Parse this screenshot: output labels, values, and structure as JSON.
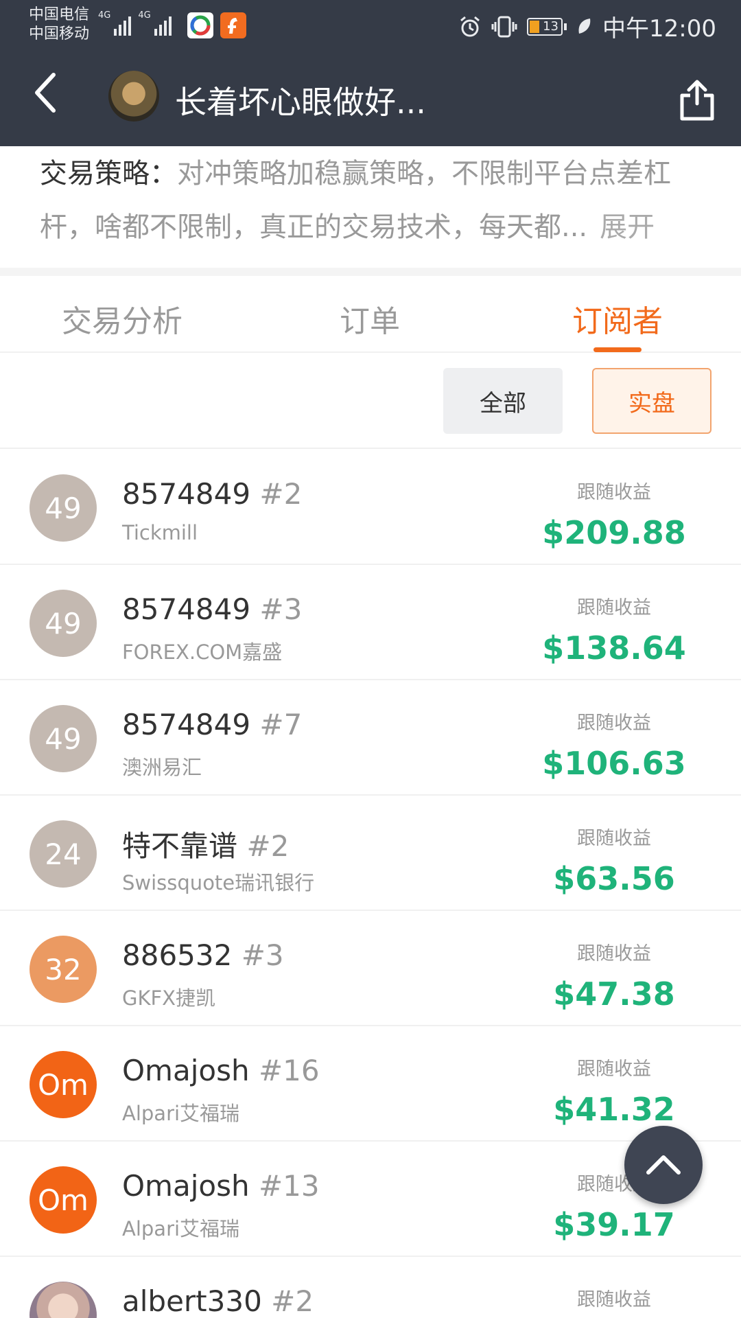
{
  "status_bar": {
    "carrier_1": "中国电信",
    "carrier_2": "中国移动",
    "network_1": "4G",
    "network_2": "4G",
    "battery": "13",
    "time": "中午12:00"
  },
  "nav": {
    "title": "长着坏心眼做好..."
  },
  "strategy": {
    "label": "交易策略：",
    "text": "对冲策略加稳赢策略，不限制平台点差杠杆，啥都不限制，真正的交易技术，每天都...",
    "expand": "展开"
  },
  "tabs": [
    {
      "label": "交易分析",
      "active": false
    },
    {
      "label": "订单",
      "active": false
    },
    {
      "label": "订阅者",
      "active": true
    }
  ],
  "filters": {
    "all": "全部",
    "real": "实盘"
  },
  "subscribers": [
    {
      "avatar_text": "49",
      "avatar_color": "#c4b9b1",
      "name": "8574849",
      "num": "#2",
      "broker": "Tickmill",
      "earn_label": "跟随收益",
      "earn": "$209.88"
    },
    {
      "avatar_text": "49",
      "avatar_color": "#c4b9b1",
      "name": "8574849",
      "num": "#3",
      "broker": "FOREX.COM嘉盛",
      "earn_label": "跟随收益",
      "earn": "$138.64"
    },
    {
      "avatar_text": "49",
      "avatar_color": "#c4b9b1",
      "name": "8574849",
      "num": "#7",
      "broker": "澳洲易汇",
      "earn_label": "跟随收益",
      "earn": "$106.63"
    },
    {
      "avatar_text": "24",
      "avatar_color": "#c4b9b1",
      "name": "特不靠谱",
      "num": "#2",
      "broker": "Swissquote瑞讯银行",
      "earn_label": "跟随收益",
      "earn": "$63.56"
    },
    {
      "avatar_text": "32",
      "avatar_color": "#eb9a62",
      "name": "886532",
      "num": "#3",
      "broker": "GKFX捷凯",
      "earn_label": "跟随收益",
      "earn": "$47.38"
    },
    {
      "avatar_text": "Om",
      "avatar_color": "#f26416",
      "name": "Omajosh",
      "num": "#16",
      "broker": "Alpari艾福瑞",
      "earn_label": "跟随收益",
      "earn": "$41.32"
    },
    {
      "avatar_text": "Om",
      "avatar_color": "#f26416",
      "name": "Omajosh",
      "num": "#13",
      "broker": "Alpari艾福瑞",
      "earn_label": "跟随收益",
      "earn": "$39.17"
    },
    {
      "avatar_text": "",
      "avatar_color": "",
      "name": "albert330",
      "num": "#2",
      "broker": "",
      "earn_label": "跟随收益",
      "earn": ""
    }
  ],
  "colors": {
    "header_bg": "#353b47",
    "accent": "#f26a1b",
    "profit": "#1fb37a"
  }
}
